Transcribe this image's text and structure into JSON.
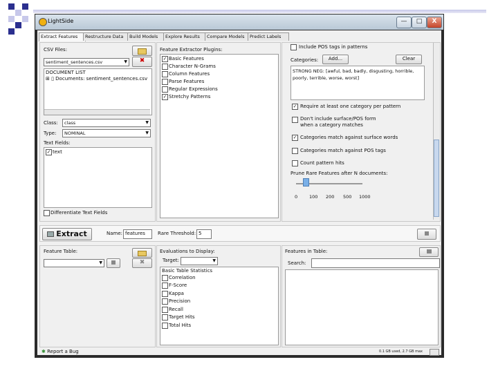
{
  "window": {
    "title": "LightSide",
    "min": "—",
    "max": "□",
    "close": "X"
  },
  "tabs": [
    "Extract Features",
    "Restructure Data",
    "Build Models",
    "Explore Results",
    "Compare Models",
    "Predict Labels"
  ],
  "extract": {
    "csv_label": "CSV Files:",
    "csv_selected": "sentiment_sentences.csv",
    "doc_list": "DOCUMENT LIST",
    "doc_item": "Documents: sentiment_sentences.csv",
    "class_label": "Class:",
    "class_value": "class",
    "type_label": "Type:",
    "type_value": "NOMINAL",
    "text_fields_label": "Text Fields:",
    "text_field_item": "text",
    "differentiate": "Differentiate Text Fields",
    "plugins_label": "Feature Extractor Plugins:",
    "plugins": [
      "Basic Features",
      "Character N-Grams",
      "Column Features",
      "Parse Features",
      "Regular Expressions",
      "Stretchy Patterns"
    ],
    "include_pos": "Include POS tags in patterns",
    "categories_label": "Categories:",
    "add_btn": "Add...",
    "clear_btn": "Clear",
    "categories_text": "STRONG NEG: [awful, bad, badly, disgusting, horrible, poorly, terrible, worse, worst]",
    "options": [
      "Require at least one category per pattern",
      "Don't include surface/POS form",
      "when a category matches",
      "Categories match against surface words",
      "Categories match against POS tags",
      "Count pattern hits"
    ],
    "prune_label": "Prune Rare Features after N documents:",
    "slider_ticks": [
      "0",
      "100",
      "200",
      "500",
      "1000"
    ],
    "extract_btn": "Extract",
    "name_label": "Name:",
    "name_value": "features",
    "rare_label": "Rare Threshold:",
    "rare_value": "5"
  },
  "bottom": {
    "feature_table_label": "Feature Table:",
    "eval_label": "Evaluations to Display:",
    "target_label": "Target:",
    "basic_stats": "Basic Table Statistics",
    "stats": [
      "Correlation",
      "F-Score",
      "Kappa",
      "Precision",
      "Recall",
      "Target Hits",
      "Total Hits"
    ],
    "features_in_table": "Features in Table:",
    "search_label": "Search:"
  },
  "status": {
    "report": "Report a Bug",
    "memory": "0.1 GB used, 2.7 GB max"
  },
  "colors": {
    "slide_accent": "#2b2f8f",
    "slide_light": "#c7c8ea",
    "red_x": "#cc0000"
  }
}
